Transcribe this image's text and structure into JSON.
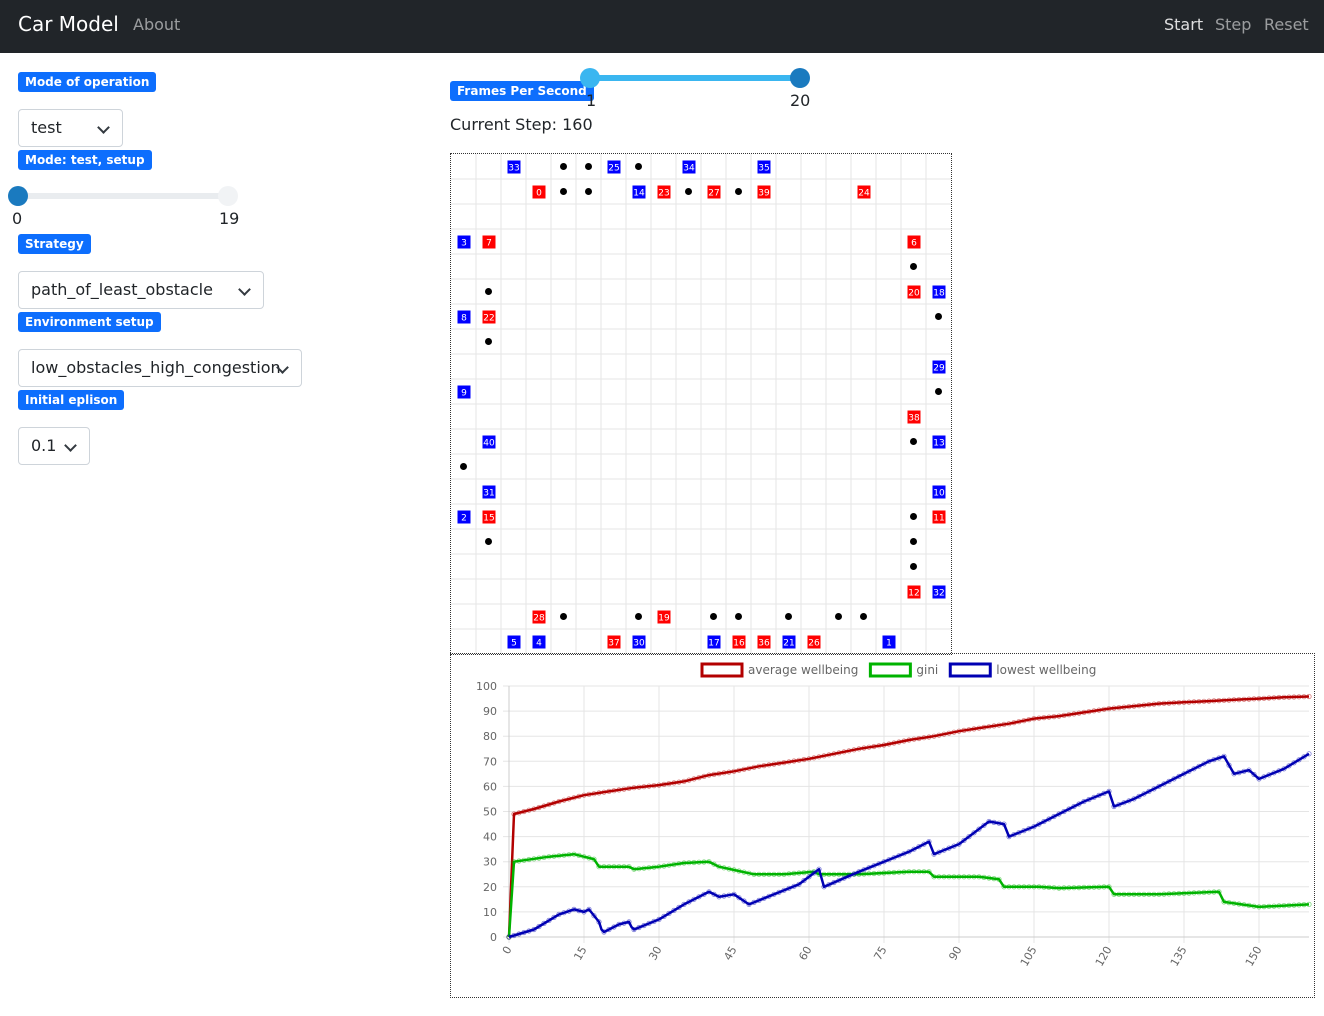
{
  "nav": {
    "brand": "Car Model",
    "about": "About",
    "start": "Start",
    "step": "Step",
    "reset": "Reset"
  },
  "sidebar": {
    "mode_badge": "Mode of operation",
    "mode_value": "test",
    "mode_setup_badge": "Mode: test, setup",
    "setup_slider": {
      "min_label": "0",
      "max_label": "19",
      "value": 0,
      "min": 0,
      "max": 19
    },
    "strategy_badge": "Strategy",
    "strategy_value": "path_of_least_obstacle",
    "env_badge": "Environment setup",
    "env_value": "low_obstacles_high_congestion",
    "epsilon_badge": "Initial eplison",
    "epsilon_value": "0.1"
  },
  "fps": {
    "badge": "Frames Per Second",
    "min_label": "1",
    "max_label": "20",
    "low": 1,
    "high": 20
  },
  "current_step": "Current Step: 160",
  "colors": {
    "red_car": "#ff0000",
    "blue_car": "#0000ff",
    "accent": "#0d6efd",
    "avg": "#b30000",
    "gini": "#00b300",
    "low": "#0000b3"
  },
  "grid": {
    "cols": 20,
    "rows": 20,
    "cars": [
      {
        "c": 2,
        "r": 0,
        "id": "33",
        "color": "blue"
      },
      {
        "c": 6,
        "r": 0,
        "id": "25",
        "color": "blue"
      },
      {
        "c": 9,
        "r": 0,
        "id": "34",
        "color": "blue"
      },
      {
        "c": 12,
        "r": 0,
        "id": "35",
        "color": "blue"
      },
      {
        "c": 3,
        "r": 1,
        "id": "0",
        "color": "red"
      },
      {
        "c": 7,
        "r": 1,
        "id": "14",
        "color": "blue"
      },
      {
        "c": 8,
        "r": 1,
        "id": "23",
        "color": "red"
      },
      {
        "c": 10,
        "r": 1,
        "id": "27",
        "color": "red"
      },
      {
        "c": 12,
        "r": 1,
        "id": "39",
        "color": "red"
      },
      {
        "c": 16,
        "r": 1,
        "id": "24",
        "color": "red"
      },
      {
        "c": 0,
        "r": 3,
        "id": "3",
        "color": "blue"
      },
      {
        "c": 1,
        "r": 3,
        "id": "7",
        "color": "red"
      },
      {
        "c": 18,
        "r": 3,
        "id": "6",
        "color": "red"
      },
      {
        "c": 18,
        "r": 5,
        "id": "20",
        "color": "red"
      },
      {
        "c": 19,
        "r": 5,
        "id": "18",
        "color": "blue"
      },
      {
        "c": 0,
        "r": 6,
        "id": "8",
        "color": "blue"
      },
      {
        "c": 1,
        "r": 6,
        "id": "22",
        "color": "red"
      },
      {
        "c": 19,
        "r": 8,
        "id": "29",
        "color": "blue"
      },
      {
        "c": 0,
        "r": 9,
        "id": "9",
        "color": "blue"
      },
      {
        "c": 18,
        "r": 10,
        "id": "38",
        "color": "red"
      },
      {
        "c": 1,
        "r": 11,
        "id": "40",
        "color": "blue"
      },
      {
        "c": 19,
        "r": 11,
        "id": "13",
        "color": "blue"
      },
      {
        "c": 1,
        "r": 13,
        "id": "31",
        "color": "blue"
      },
      {
        "c": 19,
        "r": 13,
        "id": "10",
        "color": "blue"
      },
      {
        "c": 0,
        "r": 14,
        "id": "2",
        "color": "blue"
      },
      {
        "c": 1,
        "r": 14,
        "id": "15",
        "color": "red"
      },
      {
        "c": 19,
        "r": 14,
        "id": "11",
        "color": "red"
      },
      {
        "c": 18,
        "r": 17,
        "id": "12",
        "color": "red"
      },
      {
        "c": 19,
        "r": 17,
        "id": "32",
        "color": "blue"
      },
      {
        "c": 3,
        "r": 18,
        "id": "28",
        "color": "red"
      },
      {
        "c": 8,
        "r": 18,
        "id": "19",
        "color": "red"
      },
      {
        "c": 2,
        "r": 19,
        "id": "5",
        "color": "blue"
      },
      {
        "c": 3,
        "r": 19,
        "id": "4",
        "color": "blue"
      },
      {
        "c": 6,
        "r": 19,
        "id": "37",
        "color": "red"
      },
      {
        "c": 7,
        "r": 19,
        "id": "30",
        "color": "blue"
      },
      {
        "c": 10,
        "r": 19,
        "id": "17",
        "color": "blue"
      },
      {
        "c": 11,
        "r": 19,
        "id": "16",
        "color": "red"
      },
      {
        "c": 12,
        "r": 19,
        "id": "36",
        "color": "red"
      },
      {
        "c": 13,
        "r": 19,
        "id": "21",
        "color": "blue"
      },
      {
        "c": 14,
        "r": 19,
        "id": "26",
        "color": "red"
      },
      {
        "c": 17,
        "r": 19,
        "id": "1",
        "color": "blue"
      }
    ],
    "obstacles": [
      [
        4,
        0
      ],
      [
        5,
        0
      ],
      [
        7,
        0
      ],
      [
        4,
        1
      ],
      [
        5,
        1
      ],
      [
        9,
        1
      ],
      [
        11,
        1
      ],
      [
        18,
        4
      ],
      [
        1,
        5
      ],
      [
        19,
        6
      ],
      [
        1,
        7
      ],
      [
        19,
        9
      ],
      [
        18,
        11
      ],
      [
        0,
        12
      ],
      [
        18,
        14
      ],
      [
        1,
        15
      ],
      [
        18,
        15
      ],
      [
        18,
        16
      ],
      [
        4,
        18
      ],
      [
        7,
        18
      ],
      [
        10,
        18
      ],
      [
        11,
        18
      ],
      [
        13,
        18
      ],
      [
        15,
        18
      ],
      [
        16,
        18
      ]
    ]
  },
  "chart_data": {
    "type": "line",
    "legend": [
      "average wellbeing",
      "gini",
      "lowest wellbeing"
    ],
    "ylim": [
      0,
      100
    ],
    "yticks": [
      "0",
      "10",
      "20",
      "30",
      "40",
      "50",
      "60",
      "70",
      "80",
      "90",
      "100"
    ],
    "xlim": [
      0,
      160
    ],
    "xticks": [
      "0",
      "15",
      "30",
      "45",
      "60",
      "75",
      "90",
      "105",
      "120",
      "135",
      "150"
    ],
    "series": [
      {
        "name": "average wellbeing",
        "color": "#b30000",
        "points": [
          [
            0,
            0
          ],
          [
            1,
            49
          ],
          [
            5,
            51
          ],
          [
            10,
            54
          ],
          [
            15,
            56.5
          ],
          [
            20,
            58
          ],
          [
            25,
            59.5
          ],
          [
            30,
            60.5
          ],
          [
            35,
            62
          ],
          [
            40,
            64.5
          ],
          [
            45,
            66
          ],
          [
            50,
            68
          ],
          [
            55,
            69.5
          ],
          [
            60,
            71
          ],
          [
            65,
            73
          ],
          [
            70,
            75
          ],
          [
            75,
            76.5
          ],
          [
            80,
            78.5
          ],
          [
            85,
            80
          ],
          [
            90,
            82
          ],
          [
            95,
            83.5
          ],
          [
            100,
            85
          ],
          [
            105,
            87
          ],
          [
            110,
            88
          ],
          [
            115,
            89.5
          ],
          [
            120,
            91
          ],
          [
            125,
            92
          ],
          [
            130,
            93
          ],
          [
            135,
            93.5
          ],
          [
            140,
            94
          ],
          [
            145,
            94.5
          ],
          [
            150,
            95
          ],
          [
            155,
            95.5
          ],
          [
            160,
            95.8
          ]
        ]
      },
      {
        "name": "gini",
        "color": "#00b300",
        "points": [
          [
            0,
            0
          ],
          [
            1,
            30
          ],
          [
            8,
            32
          ],
          [
            13,
            33
          ],
          [
            17,
            31
          ],
          [
            18,
            28
          ],
          [
            24,
            28
          ],
          [
            25,
            27
          ],
          [
            30,
            28
          ],
          [
            35,
            29.5
          ],
          [
            40,
            30
          ],
          [
            42,
            28
          ],
          [
            49,
            25
          ],
          [
            55,
            25
          ],
          [
            61,
            26
          ],
          [
            62,
            25
          ],
          [
            70,
            25
          ],
          [
            80,
            26
          ],
          [
            84,
            26
          ],
          [
            85,
            24
          ],
          [
            94,
            24
          ],
          [
            98,
            23
          ],
          [
            99,
            20
          ],
          [
            106,
            20
          ],
          [
            110,
            19.5
          ],
          [
            120,
            20
          ],
          [
            121,
            17
          ],
          [
            130,
            17
          ],
          [
            142,
            18
          ],
          [
            143,
            14
          ],
          [
            150,
            12
          ],
          [
            160,
            13
          ]
        ]
      },
      {
        "name": "lowest wellbeing",
        "color": "#0000b3",
        "points": [
          [
            0,
            0
          ],
          [
            5,
            3
          ],
          [
            10,
            9
          ],
          [
            13,
            11
          ],
          [
            15,
            10
          ],
          [
            16,
            11
          ],
          [
            18,
            6
          ],
          [
            18.5,
            3
          ],
          [
            19,
            2
          ],
          [
            22,
            5
          ],
          [
            24,
            6
          ],
          [
            24.5,
            4
          ],
          [
            25,
            3
          ],
          [
            30,
            7
          ],
          [
            35,
            13
          ],
          [
            40,
            18
          ],
          [
            42,
            16
          ],
          [
            45,
            17
          ],
          [
            48,
            13
          ],
          [
            53,
            17
          ],
          [
            58,
            21
          ],
          [
            62,
            27
          ],
          [
            63,
            20
          ],
          [
            70,
            26
          ],
          [
            75,
            30
          ],
          [
            80,
            34
          ],
          [
            84,
            38
          ],
          [
            85,
            33
          ],
          [
            90,
            37
          ],
          [
            96,
            46
          ],
          [
            99,
            45
          ],
          [
            100,
            40
          ],
          [
            105,
            44
          ],
          [
            110,
            49
          ],
          [
            115,
            54
          ],
          [
            120,
            58
          ],
          [
            121,
            52
          ],
          [
            125,
            55
          ],
          [
            130,
            60
          ],
          [
            135,
            65
          ],
          [
            140,
            70
          ],
          [
            143,
            72
          ],
          [
            145,
            65
          ],
          [
            148,
            66.5
          ],
          [
            150,
            63
          ],
          [
            155,
            67
          ],
          [
            160,
            73
          ]
        ]
      }
    ]
  }
}
